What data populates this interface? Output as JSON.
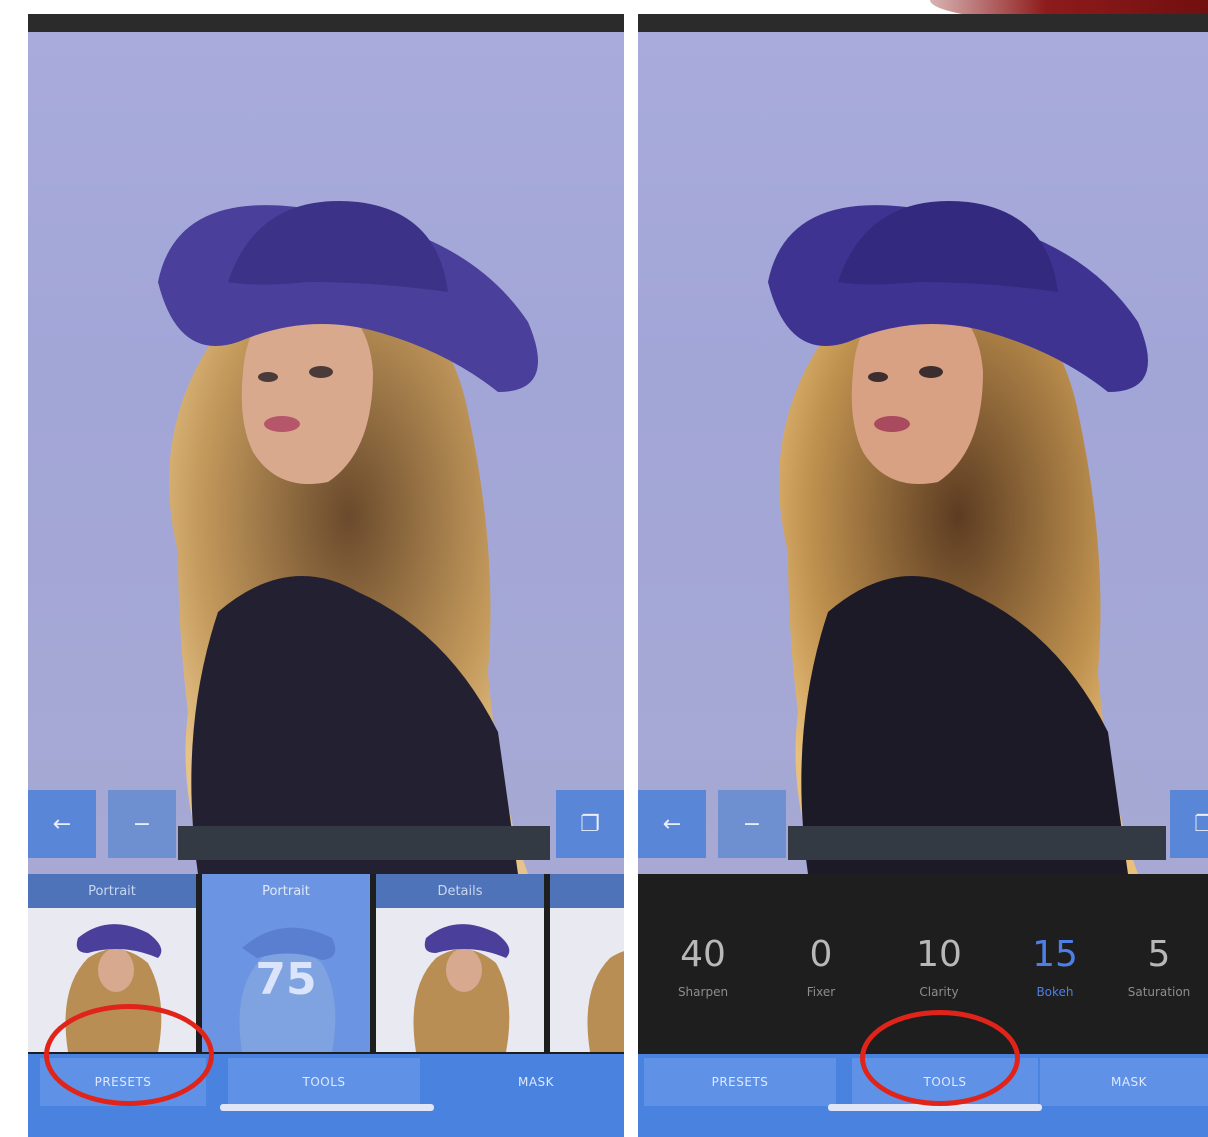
{
  "left_screen": {
    "presets": [
      {
        "label": "Portrait",
        "value": ""
      },
      {
        "label": "Portrait",
        "value": "75"
      },
      {
        "label": "Details",
        "value": ""
      }
    ],
    "tabs": [
      "PRESETS",
      "TOOLS",
      "MASK"
    ]
  },
  "right_screen": {
    "adjustments": [
      {
        "value": "40",
        "label": "Sharpen"
      },
      {
        "value": "0",
        "label": "Fixer"
      },
      {
        "value": "10",
        "label": "Clarity"
      },
      {
        "value": "15",
        "label": "Bokeh"
      },
      {
        "value": "5",
        "label": "Saturation"
      }
    ],
    "tabs": [
      "PRESETS",
      "TOOLS",
      "MASK"
    ]
  },
  "icons": {
    "back": "arrow-left-icon",
    "compare": "split-icon",
    "share": "share-icon"
  },
  "colors": {
    "accent": "#4a82e0",
    "selected_adjustment": "#4d7fe6",
    "annotation": "#e0241a"
  }
}
